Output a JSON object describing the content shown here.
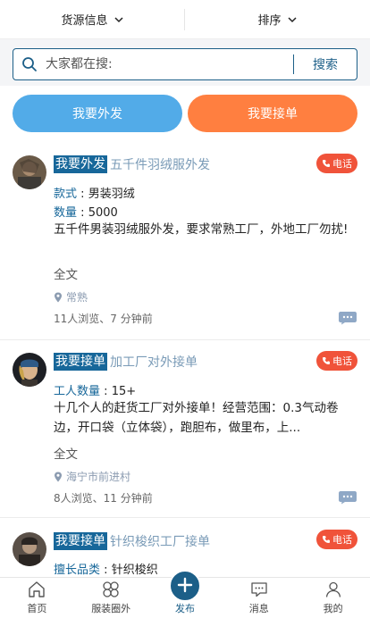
{
  "filters": {
    "source_label": "货源信息",
    "sort_label": "排序"
  },
  "search": {
    "placeholder": "大家都在搜:",
    "button_label": "搜索"
  },
  "actions": {
    "outsource_label": "我要外发",
    "accept_label": "我要接单"
  },
  "colors": {
    "primary": "#1c5f88",
    "blue_button": "#52abe8",
    "orange_button": "#ff7f40",
    "phone_red": "#f0533a",
    "tag_bg": "#17679a"
  },
  "posts": [
    {
      "tag": "我要外发",
      "title": "五千件羽绒服外发",
      "phone_label": "电话",
      "fields": [
        {
          "key": "款式",
          "sep": ":",
          "value": "男装羽绒"
        },
        {
          "key": "数量",
          "sep": ":",
          "value": "5000"
        }
      ],
      "description": "五千件男装羽绒服外发，要求常熟工厂，外地工厂勿扰!",
      "more_label": "全文",
      "location": "常熟",
      "meta": "11人浏览、7 分钟前"
    },
    {
      "tag": "我要接单",
      "title": "加工厂对外接单",
      "phone_label": "电话",
      "fields": [
        {
          "key": "工人数量",
          "sep": ":",
          "value": "15+"
        }
      ],
      "description": "十几个人的赶货工厂对外接单！经营范围：0.3气动卷边，开口袋（立体袋），跑胆布，做里布，上...",
      "more_label": "全文",
      "location": "海宁市前进村",
      "meta": "8人浏览、11 分钟前"
    },
    {
      "tag": "我要接单",
      "title": "针织梭织工厂接单",
      "phone_label": "电话",
      "fields": [
        {
          "key": "擅长品类",
          "sep": ":",
          "value": "针织梭织"
        }
      ]
    }
  ],
  "tabbar": {
    "home": "首页",
    "circle": "服装圈外",
    "publish": "发布",
    "messages": "消息",
    "mine": "我的"
  }
}
